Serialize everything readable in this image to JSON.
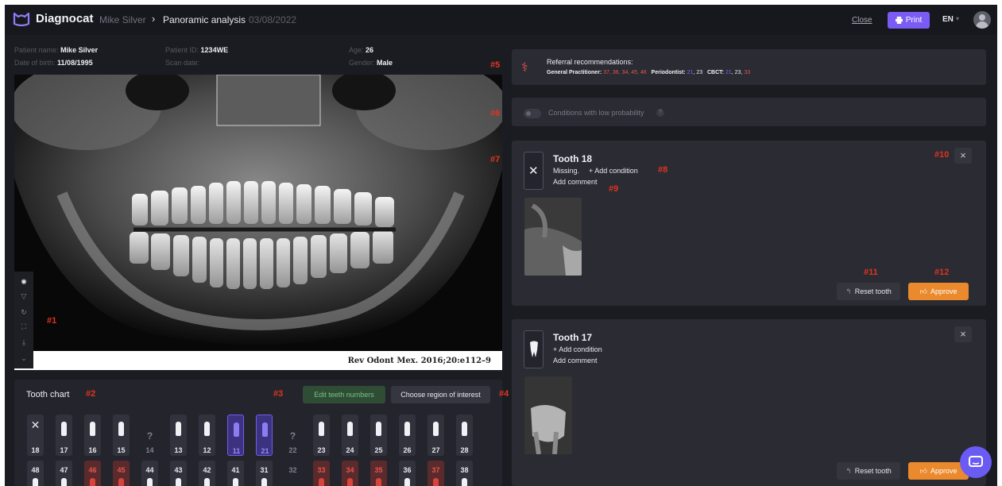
{
  "app": {
    "name": "Diagnocat",
    "colors": {
      "accent": "#7a5cf5",
      "approve": "#ea8a2d",
      "alert": "#e2574a",
      "annotation": "#e1341e"
    }
  },
  "header": {
    "patient_name": "Mike Silver",
    "separator": "›",
    "page_title": "Panoramic analysis",
    "date": "03/08/2022",
    "close_label": "Close",
    "print_label": "Print",
    "language": "EN"
  },
  "patient": {
    "name_label": "Patient name:",
    "name_value": "Mike Silver",
    "dob_label": "Date of birth:",
    "dob_value": "11/08/1995",
    "id_label": "Patient ID:",
    "id_value": "1234WE",
    "scan_label": "Scan date:",
    "scan_value": "",
    "age_label": "Age:",
    "age_value": "26",
    "gender_label": "Gender:",
    "gender_value": "Male"
  },
  "xray": {
    "credit": "Rev Odont Mex. 2016;20:e112–9"
  },
  "annotations": {
    "a1": "#1",
    "a2": "#2",
    "a3": "#3",
    "a4": "#4",
    "a5": "#5",
    "a6": "#6",
    "a7": "#7",
    "a8": "#8",
    "a9": "#9",
    "a10": "#10",
    "a11": "#11",
    "a12": "#12"
  },
  "tooth_chart": {
    "title": "Tooth chart",
    "edit_label": "Edit teeth numbers",
    "region_label": "Choose region of interest",
    "upper": [
      {
        "num": "18",
        "state": "missing"
      },
      {
        "num": "17",
        "state": "normal"
      },
      {
        "num": "16",
        "state": "normal"
      },
      {
        "num": "15",
        "state": "normal"
      },
      {
        "num": "14",
        "state": "unknown"
      },
      {
        "num": "13",
        "state": "normal"
      },
      {
        "num": "12",
        "state": "normal"
      },
      {
        "num": "11",
        "state": "selected"
      },
      {
        "num": "21",
        "state": "selected"
      },
      {
        "num": "22",
        "state": "unknown"
      },
      {
        "num": "23",
        "state": "normal"
      },
      {
        "num": "24",
        "state": "normal"
      },
      {
        "num": "25",
        "state": "normal"
      },
      {
        "num": "26",
        "state": "normal"
      },
      {
        "num": "27",
        "state": "normal"
      },
      {
        "num": "28",
        "state": "normal"
      }
    ],
    "lower": [
      {
        "num": "48",
        "state": "normal"
      },
      {
        "num": "47",
        "state": "normal"
      },
      {
        "num": "46",
        "state": "flagged"
      },
      {
        "num": "45",
        "state": "flagged"
      },
      {
        "num": "44",
        "state": "normal"
      },
      {
        "num": "43",
        "state": "normal"
      },
      {
        "num": "42",
        "state": "normal"
      },
      {
        "num": "41",
        "state": "normal"
      },
      {
        "num": "31",
        "state": "normal"
      },
      {
        "num": "32",
        "state": "empty"
      },
      {
        "num": "33",
        "state": "flagged"
      },
      {
        "num": "34",
        "state": "flagged"
      },
      {
        "num": "35",
        "state": "flagged"
      },
      {
        "num": "36",
        "state": "normal"
      },
      {
        "num": "37",
        "state": "flagged"
      },
      {
        "num": "38",
        "state": "normal"
      }
    ]
  },
  "referral": {
    "title": "Referral recommendations:",
    "gp_label": "General Practitioner:",
    "gp_teeth": "37, 36, 34, 45, 46",
    "perio_label": "Periodontist:",
    "perio_teeth_a": "21",
    "perio_teeth_b": ", 23",
    "cbct_label": "CBCT:",
    "cbct_teeth_a": "21",
    "cbct_teeth_b": ", 23, ",
    "cbct_teeth_c": "33"
  },
  "low_probability": {
    "label": "Conditions with low probability",
    "help": "?"
  },
  "card1": {
    "title": "Tooth 18",
    "status": "Missing.",
    "add_condition": "+ Add condition",
    "add_comment": "Add comment",
    "reset_label": "Reset tooth",
    "approve_label": "Approve"
  },
  "card2": {
    "title": "Tooth 17",
    "add_condition": "+ Add condition",
    "add_comment": "Add comment",
    "reset_label": "Reset tooth",
    "approve_label": "Approve"
  }
}
